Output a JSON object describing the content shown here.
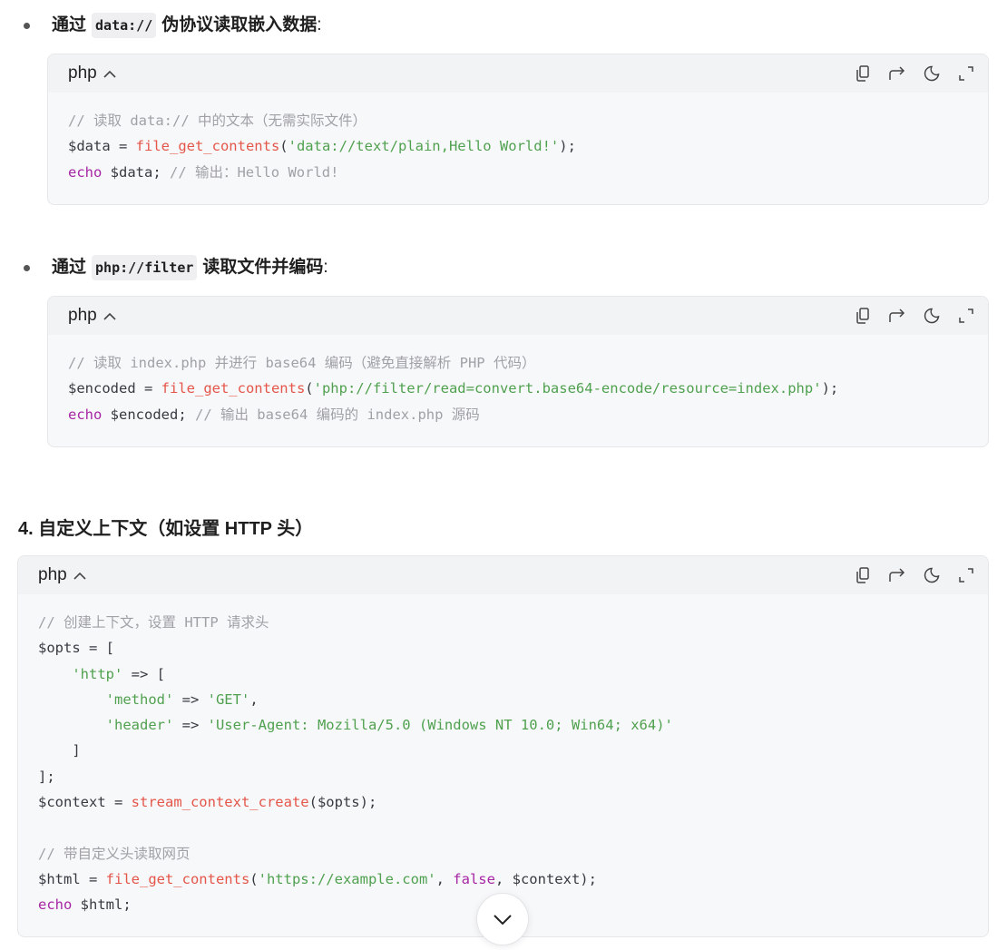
{
  "bullets": [
    {
      "prefix": "通过",
      "code": "data://",
      "suffix": "伪协议读取嵌入数据",
      "colon": ":"
    },
    {
      "prefix": "通过",
      "code": "php://filter",
      "suffix": "读取文件并编码",
      "colon": ":"
    }
  ],
  "heading": "4. 自定义上下文（如设置 HTTP 头）",
  "code_blocks": [
    {
      "lang": "php",
      "lines": [
        [
          {
            "t": "c",
            "v": "// 读取 data:// 中的文本（无需实际文件）"
          }
        ],
        [
          {
            "t": "p",
            "v": "$data = "
          },
          {
            "t": "f",
            "v": "file_get_contents"
          },
          {
            "t": "p",
            "v": "("
          },
          {
            "t": "s",
            "v": "'data://text/plain,Hello World!'"
          },
          {
            "t": "p",
            "v": ");"
          }
        ],
        [
          {
            "t": "k",
            "v": "echo"
          },
          {
            "t": "p",
            "v": " $data; "
          },
          {
            "t": "c",
            "v": "// 输出：Hello World!"
          }
        ]
      ]
    },
    {
      "lang": "php",
      "lines": [
        [
          {
            "t": "c",
            "v": "// 读取 index.php 并进行 base64 编码（避免直接解析 PHP 代码）"
          }
        ],
        [
          {
            "t": "p",
            "v": "$encoded = "
          },
          {
            "t": "f",
            "v": "file_get_contents"
          },
          {
            "t": "p",
            "v": "("
          },
          {
            "t": "s",
            "v": "'php://filter/read=convert.base64-encode/resource=index.php'"
          },
          {
            "t": "p",
            "v": ");"
          }
        ],
        [
          {
            "t": "k",
            "v": "echo"
          },
          {
            "t": "p",
            "v": " $encoded; "
          },
          {
            "t": "c",
            "v": "// 输出 base64 编码的 index.php 源码"
          }
        ]
      ]
    },
    {
      "lang": "php",
      "lines": [
        [
          {
            "t": "c",
            "v": "// 创建上下文，设置 HTTP 请求头"
          }
        ],
        [
          {
            "t": "p",
            "v": "$opts = ["
          }
        ],
        [
          {
            "t": "p",
            "v": "    "
          },
          {
            "t": "s",
            "v": "'http'"
          },
          {
            "t": "p",
            "v": " => ["
          }
        ],
        [
          {
            "t": "p",
            "v": "        "
          },
          {
            "t": "s",
            "v": "'method'"
          },
          {
            "t": "p",
            "v": " => "
          },
          {
            "t": "s",
            "v": "'GET'"
          },
          {
            "t": "p",
            "v": ","
          }
        ],
        [
          {
            "t": "p",
            "v": "        "
          },
          {
            "t": "s",
            "v": "'header'"
          },
          {
            "t": "p",
            "v": " => "
          },
          {
            "t": "s",
            "v": "'User-Agent: Mozilla/5.0 (Windows NT 10.0; Win64; x64)'"
          }
        ],
        [
          {
            "t": "p",
            "v": "    ]"
          }
        ],
        [
          {
            "t": "p",
            "v": "];"
          }
        ],
        [
          {
            "t": "p",
            "v": "$context = "
          },
          {
            "t": "f",
            "v": "stream_context_create"
          },
          {
            "t": "p",
            "v": "($opts);"
          }
        ],
        [
          {
            "t": "p",
            "v": ""
          }
        ],
        [
          {
            "t": "c",
            "v": "// 带自定义头读取网页"
          }
        ],
        [
          {
            "t": "p",
            "v": "$html = "
          },
          {
            "t": "f",
            "v": "file_get_contents"
          },
          {
            "t": "p",
            "v": "("
          },
          {
            "t": "s",
            "v": "'https://example.com'"
          },
          {
            "t": "p",
            "v": ", "
          },
          {
            "t": "k",
            "v": "false"
          },
          {
            "t": "p",
            "v": ", $context);"
          }
        ],
        [
          {
            "t": "k",
            "v": "echo"
          },
          {
            "t": "p",
            "v": " $html;"
          }
        ]
      ]
    }
  ],
  "toolbar_icons": [
    "copy-icon",
    "wrap-icon",
    "theme-moon-icon",
    "expand-icon"
  ],
  "scroll_button_icon": "chevron-down-icon",
  "colors": {
    "comment": "#a0a1a7",
    "keyword": "#a626a4",
    "function": "#e45649",
    "string": "#50a14f",
    "plain": "#383a42"
  }
}
